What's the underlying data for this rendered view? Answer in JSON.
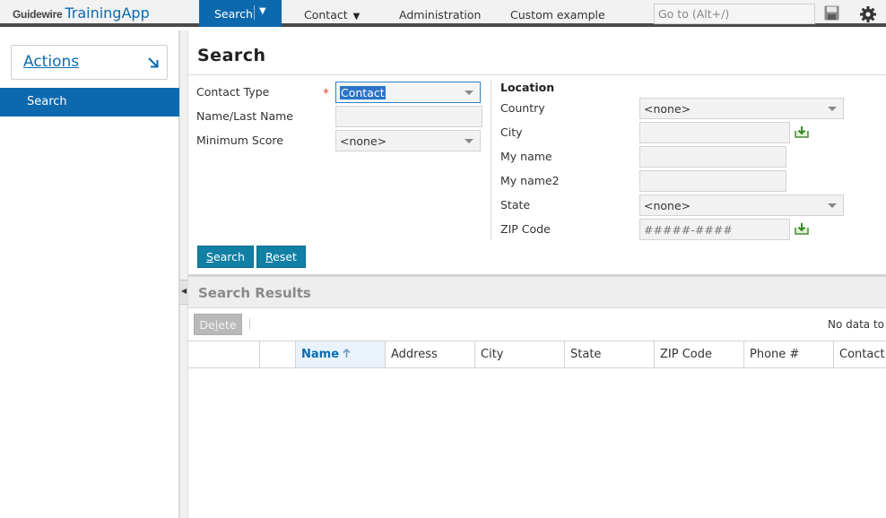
{
  "header": {
    "brand_company": "Guidewire",
    "brand_app": "TrainingApp",
    "nav": {
      "search": "Search",
      "contact": "Contact",
      "administration": "Administration",
      "custom": "Custom example"
    },
    "goto_placeholder": "Go to (Alt+/)",
    "icons": [
      "save-icon",
      "gear-icon"
    ]
  },
  "sidebar": {
    "actions_label": "Actions",
    "items": [
      {
        "label": "Search",
        "selected": true
      }
    ]
  },
  "page": {
    "title": "Search"
  },
  "form": {
    "contact_type": {
      "label": "Contact Type",
      "required_marker": "*",
      "value": "Contact"
    },
    "name": {
      "label": "Name/Last Name",
      "value": ""
    },
    "min_score": {
      "label": "Minimum Score",
      "value": "<none>"
    },
    "location": {
      "heading": "Location",
      "country": {
        "label": "Country",
        "value": "<none>"
      },
      "city": {
        "label": "City",
        "value": ""
      },
      "my_name": {
        "label": "My name",
        "value": ""
      },
      "my_name2": {
        "label": "My name2",
        "value": ""
      },
      "state": {
        "label": "State",
        "value": "<none>"
      },
      "zip": {
        "label": "ZIP Code",
        "placeholder": "#####-####"
      }
    },
    "buttons": {
      "search_u": "S",
      "search_rest": "earch",
      "reset_u": "R",
      "reset_rest": "eset"
    }
  },
  "results": {
    "title": "Search Results",
    "delete_pre": "De",
    "delete_u": "l",
    "delete_post": "ete",
    "no_data": "No data to d",
    "columns": [
      "",
      "",
      "Name",
      "Address",
      "City",
      "State",
      "ZIP Code",
      "Phone #",
      "Contact T"
    ],
    "sorted_column": "Name"
  },
  "colors": {
    "accent": "#0d69ae",
    "button_teal": "#127fa4",
    "required": "#e0472b"
  }
}
